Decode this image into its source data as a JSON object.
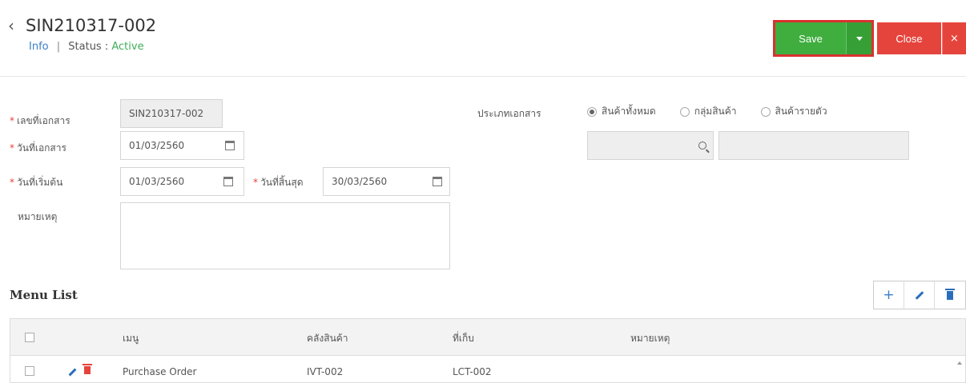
{
  "header": {
    "title": "SIN210317-002",
    "info_link": "Info",
    "separator": "|",
    "status_label": "Status :",
    "status_value": "Active",
    "save_label": "Save",
    "close_label": "Close",
    "close_x": "×"
  },
  "form": {
    "doc_no_label": "เลขที่เอกสาร",
    "doc_no_value": "SIN210317-002",
    "doc_date_label": "วันที่เอกสาร",
    "doc_date_value": "01/03/2560",
    "start_date_label": "วันที่เริ่มต้น",
    "start_date_value": "01/03/2560",
    "end_date_label": "วันที่สิ้นสุด",
    "end_date_value": "30/03/2560",
    "remark_label": "หมายเหตุ",
    "remark_value": "",
    "doc_type_label": "ประเภทเอกสาร",
    "doc_type_options": [
      "สินค้าทั้งหมด",
      "กลุ่มสินค้า",
      "สินค้ารายตัว"
    ],
    "doc_type_selected": 0,
    "product_search_value": "",
    "product_name_value": ""
  },
  "menu_list": {
    "title": "Menu List",
    "tool_add": "+",
    "columns": [
      "เมนู",
      "คลังสินค้า",
      "ที่เก็บ",
      "หมายเหตุ"
    ],
    "rows": [
      {
        "menu": "Purchase Order",
        "warehouse": "IVT-002",
        "location": "LCT-002",
        "remark": ""
      }
    ]
  },
  "colors": {
    "save_green": "#3fae3f",
    "close_red": "#e5443c",
    "highlight_red": "#d9322f",
    "link_blue": "#3a7fc8",
    "status_green": "#3fae5a"
  }
}
